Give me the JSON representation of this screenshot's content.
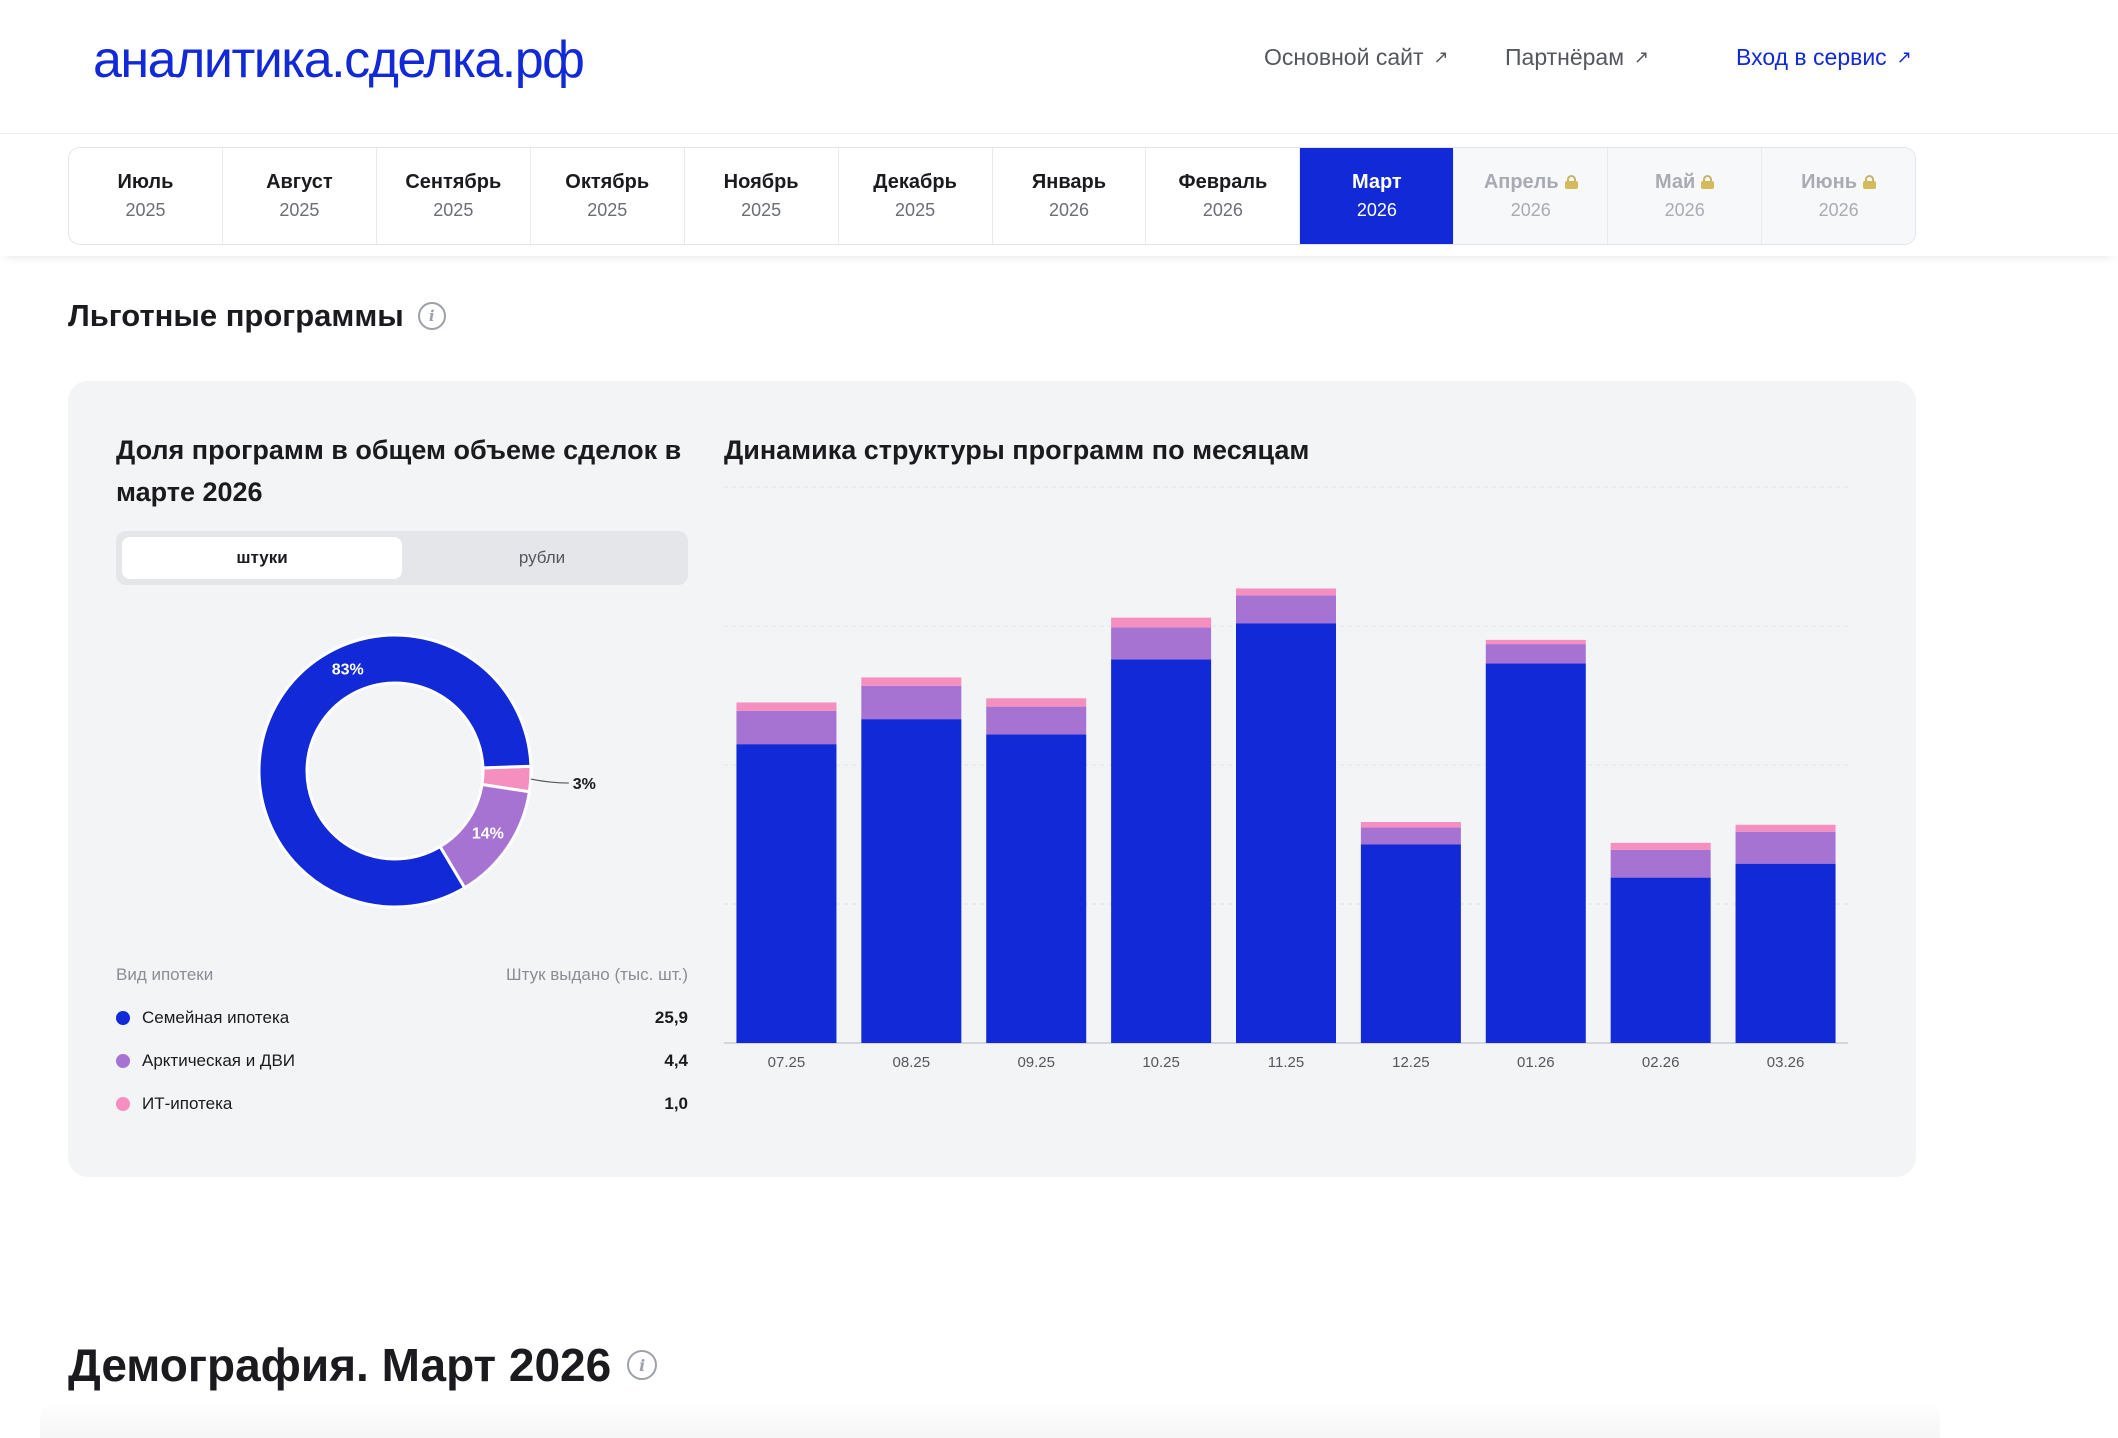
{
  "header": {
    "logo": "аналитика.сделка.рф",
    "links": [
      {
        "label": "Основной сайт",
        "icon": "arrow-up-right-icon"
      },
      {
        "label": "Партнёрам",
        "icon": "arrow-up-right-icon"
      },
      {
        "label": "Вход в сервис",
        "icon": "arrow-up-right-icon"
      }
    ]
  },
  "months": [
    {
      "name": "Июль",
      "year": "2025",
      "state": "normal"
    },
    {
      "name": "Август",
      "year": "2025",
      "state": "normal"
    },
    {
      "name": "Сентябрь",
      "year": "2025",
      "state": "normal"
    },
    {
      "name": "Октябрь",
      "year": "2025",
      "state": "normal"
    },
    {
      "name": "Ноябрь",
      "year": "2025",
      "state": "normal"
    },
    {
      "name": "Декабрь",
      "year": "2025",
      "state": "normal"
    },
    {
      "name": "Январь",
      "year": "2026",
      "state": "normal"
    },
    {
      "name": "Февраль",
      "year": "2026",
      "state": "normal"
    },
    {
      "name": "Март",
      "year": "2026",
      "state": "active"
    },
    {
      "name": "Апрель",
      "year": "2026",
      "state": "locked"
    },
    {
      "name": "Май",
      "year": "2026",
      "state": "locked"
    },
    {
      "name": "Июнь",
      "year": "2026",
      "state": "locked"
    }
  ],
  "section": {
    "title": "Льготные программы"
  },
  "left": {
    "title": "Доля программ в общем объеме сделок в марте 2026",
    "toggle": [
      {
        "label": "штуки",
        "active": true
      },
      {
        "label": "рубли",
        "active": false
      }
    ],
    "legend_header": {
      "type": "Вид ипотеки",
      "value": "Штук выдано (тыс. шт.)"
    },
    "legend": [
      {
        "label": "Семейная ипотека",
        "value": "25,9",
        "color": "#1129d6"
      },
      {
        "label": "Арктическая и ДВИ",
        "value": "4,4",
        "color": "#a673d3"
      },
      {
        "label": "ИТ-ипотека",
        "value": "1,0",
        "color": "#f48fbf"
      }
    ]
  },
  "right": {
    "title": "Динамика структуры программ по месяцам"
  },
  "chart_data": [
    {
      "type": "pie",
      "labels": [
        "Семейная ипотека",
        "Арктическая и ДВИ",
        "ИТ-ипотека"
      ],
      "values": [
        83,
        14,
        3
      ],
      "data_labels": [
        "83%",
        "14%",
        "3%"
      ],
      "colors": [
        "#1129d6",
        "#a673d3",
        "#f48fbf"
      ]
    },
    {
      "type": "bar",
      "stacked": true,
      "categories": [
        "07.25",
        "08.25",
        "09.25",
        "10.25",
        "11.25",
        "12.25",
        "01.26",
        "02.26",
        "03.26"
      ],
      "series": [
        {
          "name": "Семейная ипотека",
          "color": "#1129d6",
          "values": [
            21.5,
            23.3,
            22.2,
            27.6,
            30.2,
            14.3,
            27.3,
            11.9,
            12.9
          ]
        },
        {
          "name": "Арктическая и ДВИ",
          "color": "#a673d3",
          "values": [
            2.4,
            2.4,
            2.0,
            2.3,
            2.0,
            1.2,
            1.4,
            2.0,
            2.3
          ]
        },
        {
          "name": "ИТ-ипотека",
          "color": "#f48fbf",
          "values": [
            0.6,
            0.6,
            0.6,
            0.7,
            0.5,
            0.4,
            0.3,
            0.5,
            0.5
          ]
        }
      ],
      "ylim": [
        0,
        40
      ],
      "grid": true
    }
  ],
  "demography": {
    "title": "Демография. Март 2026"
  }
}
